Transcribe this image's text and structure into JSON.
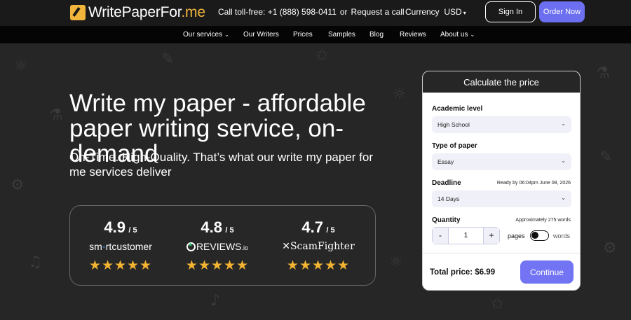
{
  "header": {
    "logo_main": "WritePaperFor",
    "logo_dot": ".me",
    "phone_label": "Call toll-free: +1 (888) 598-0411",
    "or": "or",
    "request_call": "Request a call",
    "currency_label": "Currency",
    "currency_value": "USD",
    "signin_label": "Sign In",
    "order_label": "Order Now"
  },
  "nav": {
    "items": [
      {
        "label": "Our services",
        "dropdown": true
      },
      {
        "label": "Our Writers"
      },
      {
        "label": "Prices"
      },
      {
        "label": "Samples"
      },
      {
        "label": "Blog"
      },
      {
        "label": "Reviews"
      },
      {
        "label": "About us",
        "dropdown": true
      }
    ]
  },
  "hero": {
    "title": "Write my paper - affordable paper writing service, on-demand",
    "subtitle": "On-Time. High-Quality. That’s what our write my paper for me services deliver"
  },
  "ratings": [
    {
      "score": "4.9",
      "outof": "/ 5",
      "brand_a": "sm",
      "brand_b": "rt",
      "brand_c": "customer",
      "stars": "★★★★★"
    },
    {
      "score": "4.8",
      "outof": "/ 5",
      "brand": "REVIEWS",
      "brand_suffix": "io",
      "stars": "★★★★★"
    },
    {
      "score": "4.7",
      "outof": "/ 5",
      "brand": "ScamFighter",
      "stars": "★★★★★"
    }
  ],
  "calculator": {
    "title": "Calculate the price",
    "academic_level_label": "Academic level",
    "academic_level_value": "High School",
    "paper_type_label": "Type of paper",
    "paper_type_value": "Essay",
    "deadline_label": "Deadline",
    "deadline_note": "Ready by 06:04pm June 08, 2026",
    "deadline_value": "14 Days",
    "quantity_label": "Quantity",
    "quantity_note": "Approximately 275 words",
    "quantity_value": "1",
    "minus": "-",
    "plus": "+",
    "unit_pages": "pages",
    "unit_words": "words",
    "total_label": "Total price: $6.99",
    "continue_label": "Continue"
  },
  "colors": {
    "accent": "#6c6ff0",
    "star": "#f2b431",
    "logo": "#f1b53c"
  }
}
